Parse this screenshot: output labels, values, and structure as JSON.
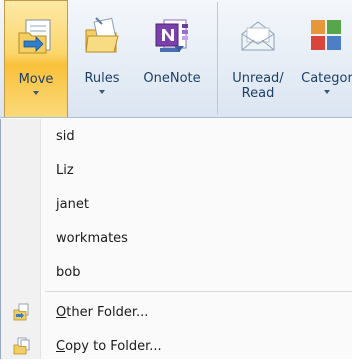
{
  "ribbon": {
    "buttons": [
      {
        "id": "move",
        "label": "Move",
        "has_dropdown": true,
        "active": true,
        "icon": "folder-move-icon"
      },
      {
        "id": "rules",
        "label": "Rules",
        "has_dropdown": true,
        "active": false,
        "icon": "rules-folder-icon"
      },
      {
        "id": "onenote",
        "label": "OneNote",
        "has_dropdown": false,
        "active": false,
        "icon": "onenote-icon"
      },
      {
        "id": "unread",
        "label_line1": "Unread/",
        "label_line2": "Read",
        "has_dropdown": false,
        "active": false,
        "icon": "envelope-icon"
      },
      {
        "id": "categorize",
        "label": "Categor",
        "has_dropdown": true,
        "active": false,
        "icon": "categorize-icon"
      }
    ]
  },
  "menu": {
    "folders": [
      "sid",
      "Liz",
      "janet",
      "workmates",
      "bob"
    ],
    "actions": [
      {
        "accel": "O",
        "rest": "ther Folder...",
        "icon": "move-to-folder-icon"
      },
      {
        "accel": "C",
        "rest": "opy to Folder...",
        "icon": "copy-to-folder-icon"
      }
    ]
  },
  "colors": {
    "active_button": "#f9c13b",
    "ribbon_text": "#1e3f66",
    "menu_bg": "#fafafa"
  }
}
